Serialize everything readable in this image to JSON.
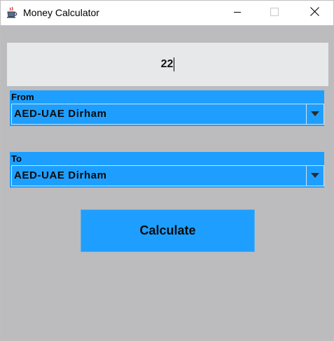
{
  "window": {
    "title": "Money Calculator",
    "icon": "java-coffee-cup-icon",
    "controls": [
      "minimize-icon",
      "maximize-icon",
      "close-icon"
    ]
  },
  "amount": {
    "value": "22"
  },
  "from": {
    "label": "From",
    "selected": "AED-UAE Dirham"
  },
  "to": {
    "label": "To",
    "selected": "AED-UAE Dirham"
  },
  "calculate": {
    "label": "Calculate"
  },
  "colors": {
    "accent": "#1e9fff",
    "background": "#bcbcbe",
    "field": "#e6e8ea"
  }
}
